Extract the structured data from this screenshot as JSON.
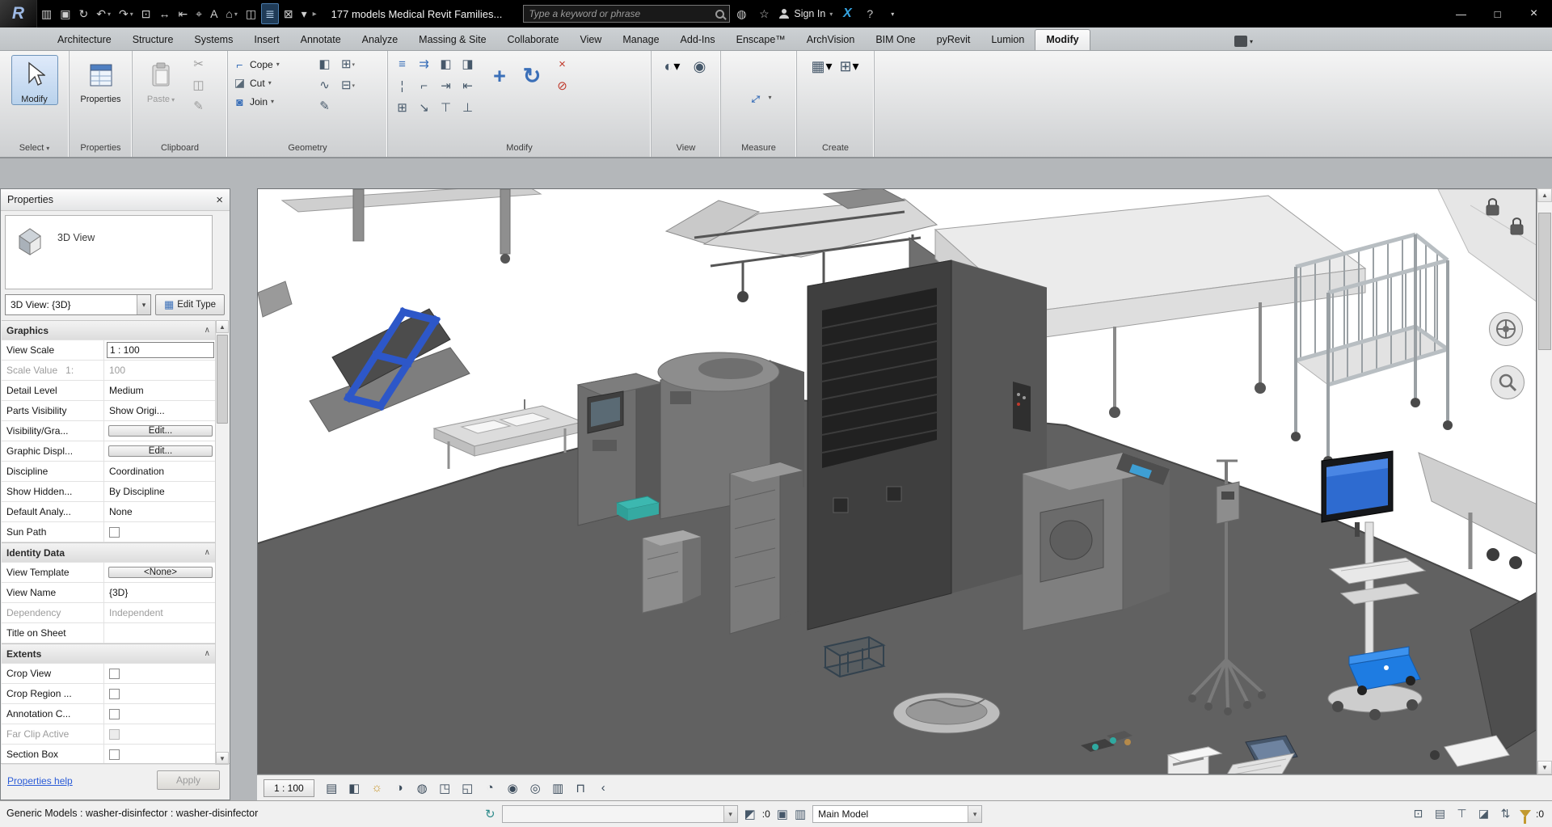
{
  "window": {
    "title": "177 models Medical Revit Families...",
    "minimize": "—",
    "maximize": "□",
    "close": "×"
  },
  "qat": [
    {
      "name": "open-icon",
      "glyph": "▥"
    },
    {
      "name": "save-icon",
      "glyph": "▣"
    },
    {
      "name": "sync-with-central-icon",
      "glyph": "↻"
    },
    {
      "name": "undo-icon",
      "glyph": "↶",
      "dropdown": true
    },
    {
      "name": "redo-icon",
      "glyph": "↷",
      "dropdown": true
    },
    {
      "name": "print-icon",
      "glyph": "⊡"
    },
    {
      "name": "measure-icon",
      "glyph": "↔"
    },
    {
      "name": "aligned-dimension-icon",
      "glyph": "⇤"
    },
    {
      "name": "tag-by-category-icon",
      "glyph": "⌖"
    },
    {
      "name": "text-icon",
      "glyph": "A"
    },
    {
      "name": "default-3d-view-icon",
      "glyph": "⌂",
      "dropdown": true
    },
    {
      "name": "section-icon",
      "glyph": "◫"
    },
    {
      "name": "thin-lines-icon",
      "glyph": "≣",
      "active": true
    },
    {
      "name": "close-hidden-windows-icon",
      "glyph": "⊠"
    },
    {
      "name": "customize-qat-icon",
      "glyph": "▾"
    }
  ],
  "qat_overflow": "▸",
  "search": {
    "placeholder": "Type a keyword or phrase"
  },
  "account": {
    "sign_in": "Sign In",
    "exchange": "X",
    "help": "?"
  },
  "tabs": {
    "items": [
      "Architecture",
      "Structure",
      "Systems",
      "Insert",
      "Annotate",
      "Analyze",
      "Massing & Site",
      "Collaborate",
      "View",
      "Manage",
      "Add-Ins",
      "Enscape™",
      "ArchVision",
      "BIM One",
      "pyRevit",
      "Lumion",
      "Modify"
    ],
    "active": "Modify"
  },
  "ribbon": {
    "select": {
      "button": "Modify",
      "panel": "Select"
    },
    "properties": {
      "button": "Properties",
      "panel": "Properties"
    },
    "clipboard": {
      "button": "Paste",
      "panel": "Clipboard",
      "small": [
        {
          "name": "cut-icon",
          "glyph": "✂"
        },
        {
          "name": "copy-icon",
          "glyph": "◫"
        },
        {
          "name": "match-type-properties-icon",
          "glyph": "✎"
        }
      ]
    },
    "geometry": {
      "panel": "Geometry",
      "rows": [
        {
          "name": "cope-button",
          "label": "Cope",
          "glyph": "⌐",
          "color": "#3a6fb8"
        },
        {
          "name": "cut-geometry-button",
          "label": "Cut",
          "glyph": "◪",
          "color": "#5a6a78"
        },
        {
          "name": "join-button",
          "label": "Join",
          "glyph": "◙",
          "color": "#3a6fb8"
        }
      ],
      "extra": [
        {
          "name": "apply-coping-icon",
          "glyph": "◧"
        },
        {
          "name": "wall-profile-icon",
          "glyph": "∿"
        },
        {
          "name": "demolish-icon",
          "glyph": "✎"
        }
      ],
      "extra2": [
        {
          "name": "cut-profile-icon",
          "glyph": "⊞",
          "dropdown": true
        },
        {
          "name": "edit-profile-icon",
          "glyph": "⊟",
          "dropdown": true
        }
      ]
    },
    "modify_panel": {
      "panel": "Modify",
      "grid": [
        {
          "name": "align-icon",
          "glyph": "≡",
          "color": "#3a6fb8"
        },
        {
          "name": "offset-icon",
          "glyph": "⇉",
          "color": "#3a6fb8"
        },
        {
          "name": "mirror-pick-axis-icon",
          "glyph": "◧"
        },
        {
          "name": "mirror-draw-axis-icon",
          "glyph": "◨"
        },
        {
          "name": "split-element-icon",
          "glyph": "¦"
        },
        {
          "name": "trim-extend-corner-icon",
          "glyph": "⌐"
        },
        {
          "name": "trim-extend-single-icon",
          "glyph": "⇥"
        },
        {
          "name": "trim-extend-multiple-icon",
          "glyph": "⇤"
        },
        {
          "name": "array-icon",
          "glyph": "⊞"
        },
        {
          "name": "scale-icon",
          "glyph": "↘"
        },
        {
          "name": "pin-icon",
          "glyph": "⊤"
        },
        {
          "name": "unpin-icon",
          "glyph": "⊥"
        }
      ],
      "big": [
        {
          "name": "move-icon",
          "glyph": "+"
        },
        {
          "name": "rotate-icon",
          "glyph": "↻"
        }
      ],
      "extra": [
        {
          "name": "delete-icon",
          "glyph": "×",
          "color": "#c0392b"
        },
        {
          "name": "disallow-join-icon",
          "glyph": "⊘",
          "color": "#c0392b"
        }
      ]
    },
    "view_panel": {
      "panel": "View",
      "icons": [
        {
          "name": "temporary-hide-isolate-icon",
          "glyph": "◐",
          "dropdown": true
        },
        {
          "name": "reveal-hidden-elements-icon",
          "glyph": "◉"
        }
      ]
    },
    "measure": {
      "panel": "Measure",
      "icon_glyph": "↔"
    },
    "create": {
      "panel": "Create",
      "icons": [
        {
          "name": "create-parts-icon",
          "glyph": "▦",
          "dropdown": true
        },
        {
          "name": "create-assembly-icon",
          "glyph": "⊞",
          "dropdown": true
        }
      ]
    }
  },
  "properties": {
    "title": "Properties",
    "type_label": "3D View",
    "selector": "3D View: {3D}",
    "edit_type": "Edit Type",
    "help": "Properties help",
    "apply": "Apply",
    "sections": [
      {
        "name": "Graphics",
        "rows": [
          {
            "label": "View Scale",
            "value": "1 : 100",
            "kind": "input",
            "focus": true
          },
          {
            "label": "Scale Value   1:",
            "value": "100",
            "kind": "disabled"
          },
          {
            "label": "Detail Level",
            "value": "Medium",
            "kind": "select"
          },
          {
            "label": "Parts Visibility",
            "value": "Show Origi...",
            "kind": "select"
          },
          {
            "label": "Visibility/Gra...",
            "value": "Edit...",
            "kind": "button"
          },
          {
            "label": "Graphic Displ...",
            "value": "Edit...",
            "kind": "button"
          },
          {
            "label": "Discipline",
            "value": "Coordination",
            "kind": "select"
          },
          {
            "label": "Show Hidden...",
            "value": "By Discipline",
            "kind": "select"
          },
          {
            "label": "Default Analy...",
            "value": "None",
            "kind": "select"
          },
          {
            "label": "Sun Path",
            "value": "",
            "kind": "checkbox"
          }
        ]
      },
      {
        "name": "Identity Data",
        "rows": [
          {
            "label": "View Template",
            "value": "<None>",
            "kind": "button"
          },
          {
            "label": "View Name",
            "value": "{3D}",
            "kind": "input"
          },
          {
            "label": "Dependency",
            "value": "Independent",
            "kind": "disabled"
          },
          {
            "label": "Title on Sheet",
            "value": "",
            "kind": "input"
          }
        ]
      },
      {
        "name": "Extents",
        "rows": [
          {
            "label": "Crop View",
            "value": "",
            "kind": "checkbox"
          },
          {
            "label": "Crop Region ...",
            "value": "",
            "kind": "checkbox"
          },
          {
            "label": "Annotation C...",
            "value": "",
            "kind": "checkbox"
          },
          {
            "label": "Far Clip Active",
            "value": "",
            "kind": "checkbox-disabled"
          },
          {
            "label": "Section Box",
            "value": "",
            "kind": "checkbox"
          }
        ]
      }
    ]
  },
  "viewbar": {
    "scale": "1 : 100",
    "icons": [
      {
        "name": "detail-level-icon",
        "glyph": "▤"
      },
      {
        "name": "visual-style-icon",
        "glyph": "◧"
      },
      {
        "name": "sun-path-icon",
        "glyph": "☼",
        "color": "#c8962a"
      },
      {
        "name": "shadows-icon",
        "glyph": "◑"
      },
      {
        "name": "rendering-dialog-icon",
        "glyph": "◍"
      },
      {
        "name": "crop-view-icon",
        "glyph": "◳"
      },
      {
        "name": "show-crop-region-icon",
        "glyph": "◱"
      },
      {
        "name": "temporary-hide-isolate-icon",
        "glyph": "◔"
      },
      {
        "name": "reveal-hidden-elements-icon",
        "glyph": "◉"
      },
      {
        "name": "worksharing-display-icon",
        "glyph": "◎"
      },
      {
        "name": "temporary-view-properties-icon",
        "glyph": "▥"
      },
      {
        "name": "show-constraints-icon",
        "glyph": "⊓"
      },
      {
        "name": "collapse-viewbar-icon",
        "glyph": "‹"
      }
    ]
  },
  "statusbar": {
    "message": "Generic Models : washer-disinfector : washer-disinfector",
    "requests_count": ":0",
    "main_model": "Main Model",
    "filter_count": ":0",
    "right_icons": [
      {
        "name": "select-links-icon",
        "glyph": "⊡"
      },
      {
        "name": "select-underlay-elements-icon",
        "glyph": "▤"
      },
      {
        "name": "select-pinned-elements-icon",
        "glyph": "⊤"
      },
      {
        "name": "select-elements-by-face-icon",
        "glyph": "◪"
      },
      {
        "name": "drag-elements-icon",
        "glyph": "⇅"
      }
    ]
  }
}
